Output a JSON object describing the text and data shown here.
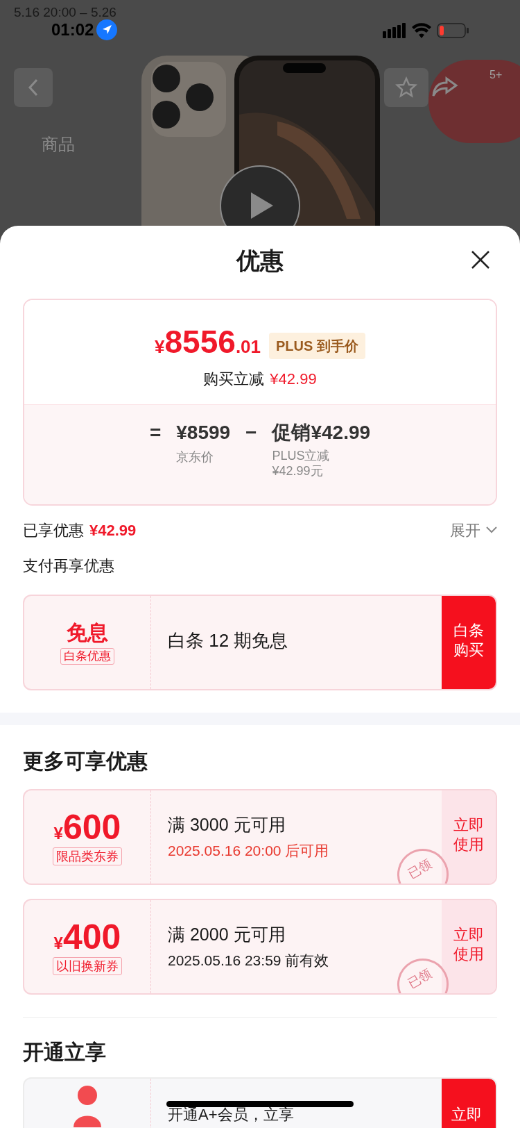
{
  "background": {
    "status_bar": {
      "event": "5.16 20:00 – 5.26",
      "time": "01:02"
    },
    "badge": "5+",
    "tabs": [
      {
        "label": "商品",
        "selected": false
      }
    ]
  },
  "sheet": {
    "title": "优惠",
    "price": {
      "currency": "¥",
      "integer": "8556",
      "decimal": ".01",
      "tag": "PLUS 到手价",
      "saving_label": "购买立减",
      "saving_value": "¥42.99"
    },
    "formula": {
      "equals": "=",
      "base": "¥8599",
      "base_label": "京东价",
      "minus": "−",
      "promo": "促销¥42.99",
      "promo_label": "PLUS立减",
      "promo_amount": "¥42.99元"
    },
    "enjoyed": {
      "label": "已享优惠",
      "value": "¥42.99",
      "expand": "展开",
      "expanded": false
    },
    "pay_heading": "支付再享优惠",
    "sections": [
      {
        "kind": "baitiao",
        "title": "免息",
        "tag": "白条优惠",
        "text": "白条 12 期免息",
        "action": "白条购买"
      },
      {
        "kind": "gap"
      },
      {
        "kind": "heading",
        "text": "更多可享优惠"
      },
      {
        "kind": "coupon",
        "currency": "¥",
        "amount": "600",
        "tag": "限品类东券",
        "text": "满 3000 元可用",
        "note": "2025.05.16 20:00 后可用",
        "note_highlight": true,
        "stamp": "已领",
        "action": "立即使用"
      },
      {
        "kind": "coupon",
        "currency": "¥",
        "amount": "400",
        "tag": "以旧换新券",
        "text": "满 2000 元可用",
        "note": "2025.05.16 23:59 前有效",
        "note_highlight": false,
        "stamp": "已领",
        "action": "立即使用"
      },
      {
        "kind": "rule"
      },
      {
        "kind": "heading",
        "text": "开通立享"
      },
      {
        "kind": "member",
        "text": "开通A+会员，立享",
        "action": "立即"
      }
    ]
  }
}
